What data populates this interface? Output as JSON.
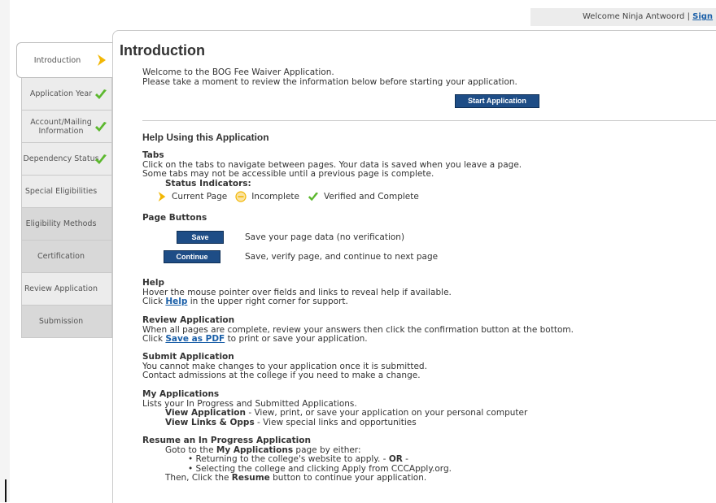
{
  "header": {
    "welcome": "Welcome Ninja Antwoord |",
    "sign_link": "Sign"
  },
  "sidebar": {
    "tabs": [
      {
        "label": "Introduction",
        "status": "current"
      },
      {
        "label": "Application Year",
        "status": "verified"
      },
      {
        "label": "Account/Mailing Information",
        "status": "verified"
      },
      {
        "label": "Dependency Status",
        "status": "verified"
      },
      {
        "label": "Special Eligibilities",
        "status": "none"
      },
      {
        "label": "Eligibility Methods",
        "status": "none"
      },
      {
        "label": "Certification",
        "status": "none"
      },
      {
        "label": "Review Application",
        "status": "none"
      },
      {
        "label": "Submission",
        "status": "none"
      }
    ]
  },
  "main": {
    "title": "Introduction",
    "intro_line1": "Welcome to the BOG Fee Waiver Application.",
    "intro_line2": "Please take a moment to review the information below before starting your application.",
    "start_button": "Start Application",
    "help_heading": "Help Using this Application",
    "tabs_section": {
      "heading": "Tabs",
      "line1": "Click on the tabs to navigate between pages. Your data is saved when you leave a page.",
      "line2": "Some tabs may not be accessible until a previous page is complete.",
      "indicators_heading": "Status Indicators:",
      "current": "Current Page",
      "incomplete": "Incomplete",
      "verified": "Verified and Complete"
    },
    "page_buttons": {
      "heading": "Page Buttons",
      "save_label": "Save",
      "save_desc": "Save your page data (no verification)",
      "continue_label": "Continue",
      "continue_desc": "Save, verify page, and continue to next page"
    },
    "help_section": {
      "heading": "Help",
      "line1": "Hover the mouse pointer over fields and links to reveal help if available.",
      "line2_pre": "Click",
      "line2_link": "Help",
      "line2_post": "in the upper right corner for support."
    },
    "review_section": {
      "heading": "Review Application",
      "line1": "When all pages are complete, review your answers then click the confirmation button at the bottom.",
      "line2_pre": "Click",
      "line2_link": "Save as PDF",
      "line2_post": "to print or save your application."
    },
    "submit_section": {
      "heading": "Submit Application",
      "line1": "You cannot make changes to your application once it is submitted.",
      "line2": "Contact admissions at the college if you need to make a change."
    },
    "myapps_section": {
      "heading": "My Applications",
      "line1": "Lists your In Progress and Submitted Applications.",
      "view_app_b": "View Application",
      "view_app_rest": "- View, print, or save your application on your personal computer",
      "view_links_b": "View Links & Opps",
      "view_links_rest": "- View special links and opportunities"
    },
    "resume_section": {
      "heading": "Resume an In Progress Application",
      "line1_pre": "Goto to the",
      "line1_b": "My Applications",
      "line1_post": "page by either:",
      "bullet1_pre": "• Returning to the college's website to apply. -",
      "bullet1_b": "OR",
      "bullet1_post": "-",
      "bullet2": "• Selecting the college and clicking Apply from CCCApply.org.",
      "line_last_pre": "Then, Click the",
      "line_last_b": "Resume",
      "line_last_post": "button to continue your application."
    }
  },
  "colors": {
    "button": "#1e4d86",
    "check": "#5cb82e",
    "arrow": "#f2b705",
    "link": "#1a5fa8"
  }
}
